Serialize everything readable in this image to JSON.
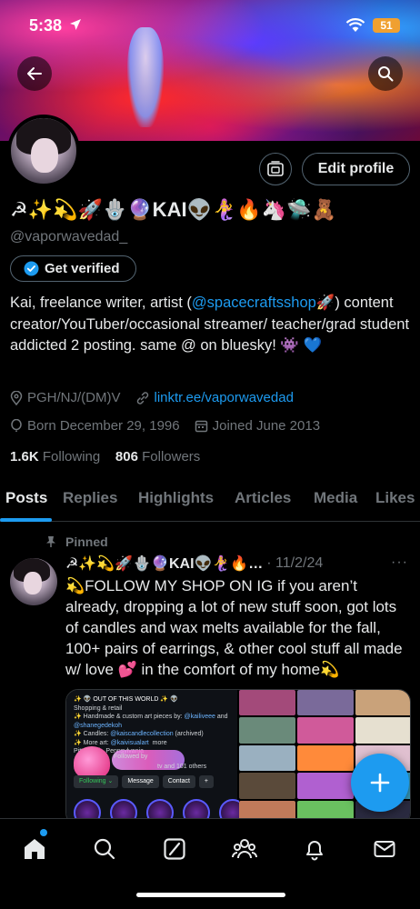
{
  "status": {
    "time": "5:38",
    "battery": "51"
  },
  "profile": {
    "display_name": "☭✨💫🚀🪬🔮KAI👽🧜‍♀️🔥🦄🛸🧸",
    "handle": "@vaporwavedad_",
    "verify_label": "Get verified",
    "edit_label": "Edit profile",
    "bio_pre": "Kai, freelance writer, artist (",
    "bio_link": "@spacecraftsshop",
    "bio_post": "🚀) content creator/YouTuber/occasional streamer/ teacher/grad student addicted 2 posting. same @ on bluesky! 👾 💙",
    "location": "PGH/NJ/(DM)V",
    "website": "linktr.ee/vaporwavedad",
    "born": "Born December 29, 1996",
    "joined": "Joined June 2013",
    "following_count": "1.6K",
    "following_label": "Following",
    "followers_count": "806",
    "followers_label": "Followers"
  },
  "tabs": [
    "Posts",
    "Replies",
    "Highlights",
    "Articles",
    "Media",
    "Likes"
  ],
  "post": {
    "pinned_label": "Pinned",
    "author_name": "☭✨💫🚀🪬🔮KAI👽🧜‍♀️🔥…",
    "date": "· 11/2/24",
    "more": "···",
    "text": "💫FOLLOW MY SHOP ON IG if you aren’t already, dropping a lot of new stuff soon, got lots of candles and wax melts available for the fall, 100+ pairs of earrings, & other cool stuff all made w/ love 💕 in the comfort of my home💫",
    "media_left": {
      "title": "✨ 👽 OUT OF THIS WORLD ✨ 👽",
      "category": "Shopping & retail",
      "line1_pre": "✨ Handmade & custom art pieces by: ",
      "line1_link1": "@kailiveee",
      "line1_and": " and ",
      "line1_link2": "@shanegedekoh",
      "line2_pre": "✨ Candles: ",
      "line2_link": "@kaiscandlecollection",
      "line2_post": " (archived)",
      "line3_pre": "✨ More art: ",
      "line3_link": "@kaivisualart",
      "line3_more": "more",
      "location": "Pittsburgh, Pennsylvania",
      "followed_by": "Followed by ",
      "followed_tail": "tv and 101 others",
      "btn_following": "Following ⌄",
      "btn_message": "Message",
      "btn_contact": "Contact"
    }
  },
  "colors": {
    "accent": "#1d9bf0",
    "muted": "#71767b",
    "text": "#e7e9ea",
    "border": "#2f3336"
  }
}
